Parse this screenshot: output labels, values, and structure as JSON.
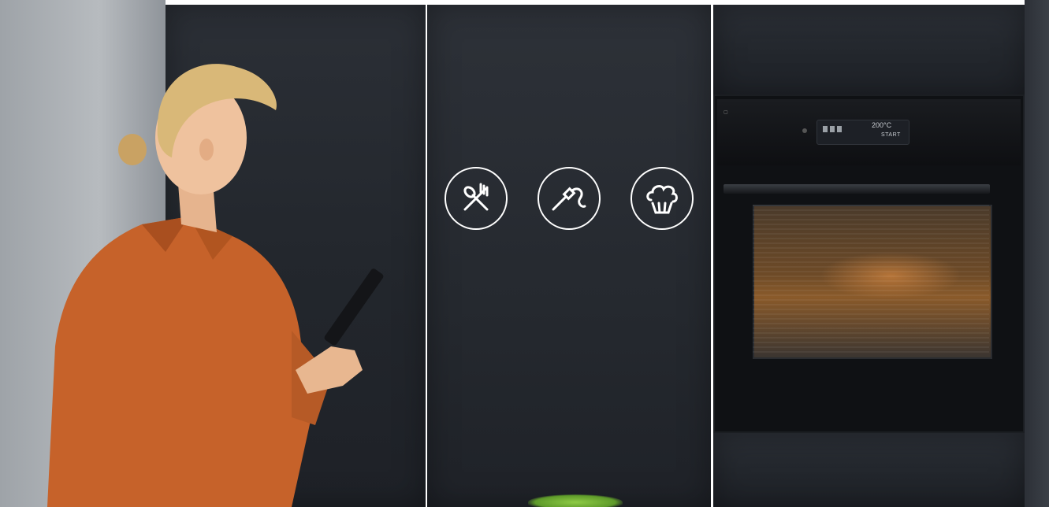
{
  "scene": {
    "description_free": true
  },
  "icons": [
    {
      "name": "cutlery-icon"
    },
    {
      "name": "food-probe-icon"
    },
    {
      "name": "steam-icon"
    }
  ],
  "oven": {
    "display": {
      "temperature": "200°C",
      "start": "START"
    }
  },
  "colors": {
    "panel": "#262a30",
    "blouse": "#c9642b",
    "icon_stroke": "#ffffff"
  }
}
